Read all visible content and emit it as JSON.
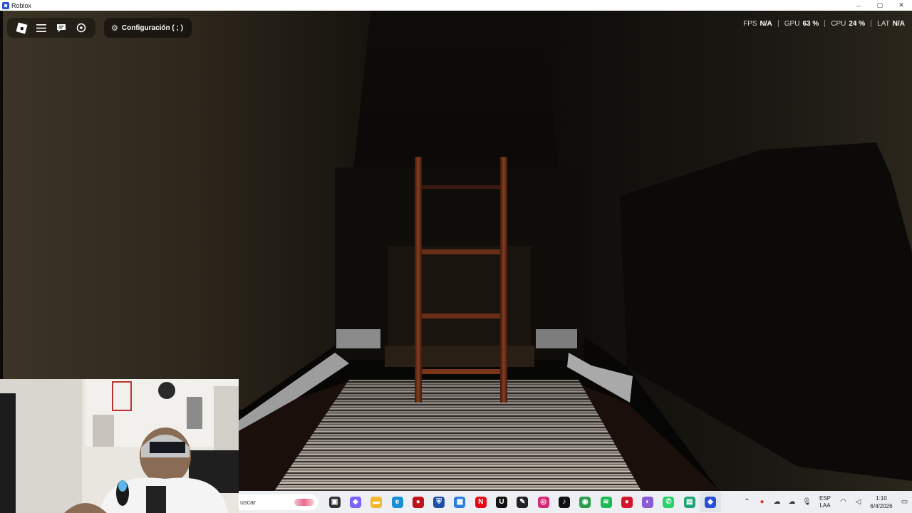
{
  "window": {
    "title": "Roblox",
    "controls": [
      "–",
      "▢",
      "✕"
    ]
  },
  "roblox_topbar": {
    "settings_label": "Configuración ( ; )",
    "buttons": [
      "roblox-menu",
      "hamburger-menu",
      "chat",
      "emotes"
    ]
  },
  "stats": [
    {
      "label": "FPS",
      "value": "N/A"
    },
    {
      "label": "GPU",
      "value": "63 %"
    },
    {
      "label": "CPU",
      "value": "24 %"
    },
    {
      "label": "LAT",
      "value": "N/A"
    }
  ],
  "taskbar": {
    "search_placeholder": "uscar",
    "apps": [
      {
        "name": "task-view",
        "color": "#333333",
        "glyph": "▣"
      },
      {
        "name": "copilot",
        "color": "#7b61ff",
        "glyph": "◆"
      },
      {
        "name": "file-explorer",
        "color": "#f2b632",
        "glyph": "▬"
      },
      {
        "name": "edge",
        "color": "#1b8fd6",
        "glyph": "e"
      },
      {
        "name": "app-red",
        "color": "#c0121b",
        "glyph": "●"
      },
      {
        "name": "app-shield",
        "color": "#1e4fa8",
        "glyph": "⛨"
      },
      {
        "name": "store",
        "color": "#2b7de0",
        "glyph": "▦"
      },
      {
        "name": "netflix",
        "color": "#e50914",
        "glyph": "N"
      },
      {
        "name": "app-u",
        "color": "#111111",
        "glyph": "U"
      },
      {
        "name": "app-notes",
        "color": "#222222",
        "glyph": "✎"
      },
      {
        "name": "instagram",
        "color": "#d62976",
        "glyph": "◎"
      },
      {
        "name": "tiktok",
        "color": "#111111",
        "glyph": "♪"
      },
      {
        "name": "chrome",
        "color": "#2a9d4a",
        "glyph": "◉"
      },
      {
        "name": "spotify",
        "color": "#1db954",
        "glyph": "≋"
      },
      {
        "name": "app-record",
        "color": "#d3162b",
        "glyph": "●"
      },
      {
        "name": "app-circle",
        "color": "#8a5bd6",
        "glyph": "◐"
      },
      {
        "name": "whatsapp",
        "color": "#25d366",
        "glyph": "✆"
      },
      {
        "name": "app-green",
        "color": "#1fa37a",
        "glyph": "▤"
      },
      {
        "name": "roblox",
        "color": "#2a4fd6",
        "glyph": "◆",
        "active": true
      }
    ],
    "tray": {
      "language_top": "ESP",
      "language_bottom": "LAA",
      "time": "1:10",
      "date": "6/4/2026"
    }
  }
}
